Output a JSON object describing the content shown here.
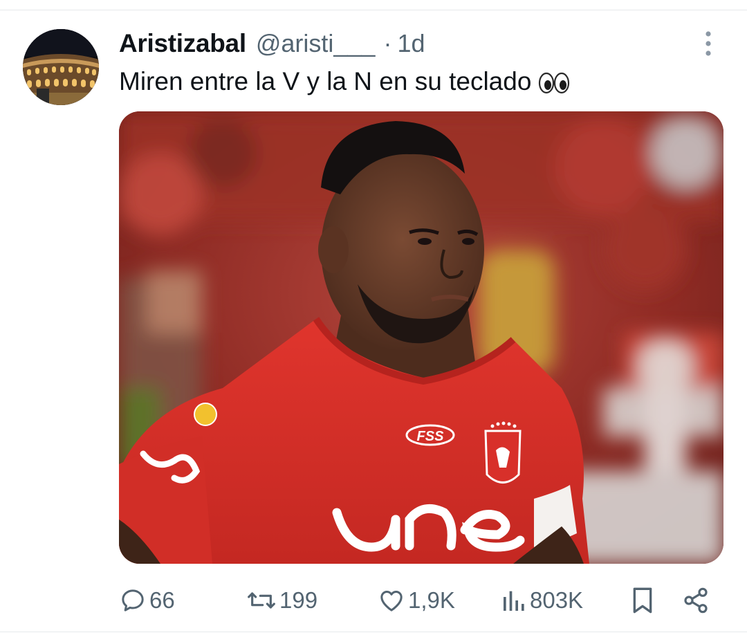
{
  "tweet": {
    "display_name": "Aristizabal",
    "handle": "@aristi___",
    "separator": "·",
    "time": "1d",
    "text": "Miren entre la V y la N en su teclado",
    "emoji": "eyes-emoji",
    "avatar": "colosseum-at-night",
    "media": {
      "description_kind": "photo",
      "shirt_sponsor": "une",
      "shirt_brand": "FSS"
    }
  },
  "actions": {
    "replies": "66",
    "reposts": "199",
    "likes": "1,9K",
    "views": "803K"
  },
  "icons": {
    "reply": "reply-icon",
    "repost": "repost-icon",
    "like": "like-icon",
    "views": "views-icon",
    "bookmark": "bookmark-icon",
    "share": "share-icon",
    "more": "more-icon"
  },
  "colors": {
    "text_primary": "#0f1419",
    "text_secondary": "#536471",
    "divider": "#e6e9ec",
    "jersey_red": "#d8302a"
  }
}
